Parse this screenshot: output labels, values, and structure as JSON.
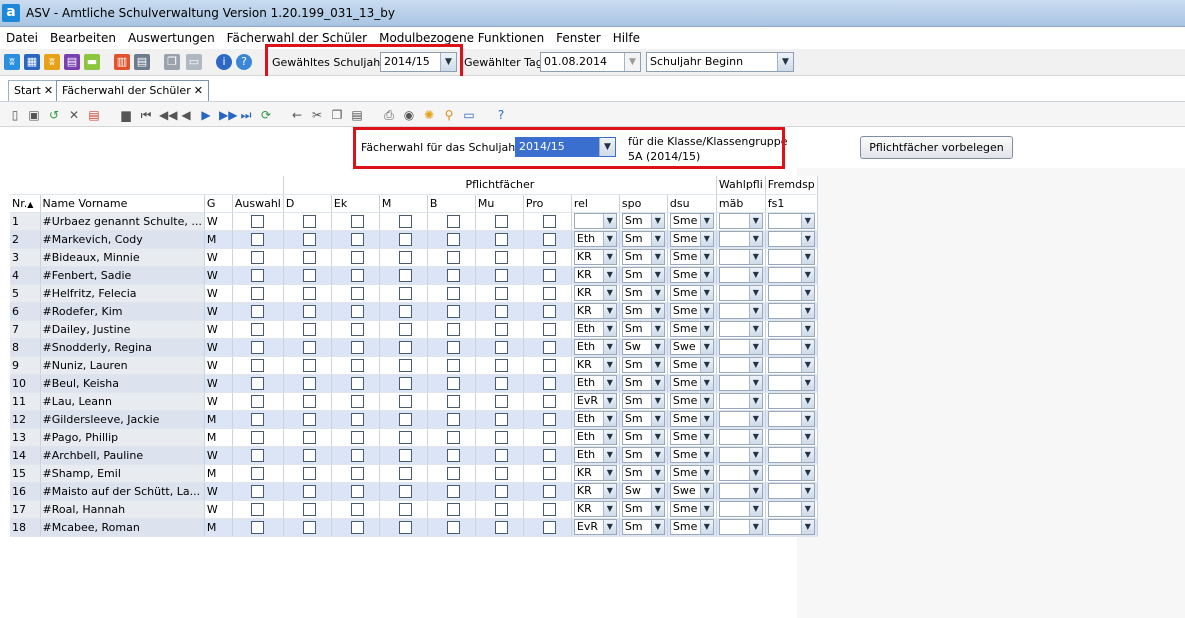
{
  "window": {
    "title": "ASV - Amtliche Schulverwaltung Version 1.20.199_031_13_by",
    "app_icon": "a"
  },
  "menu": [
    "Datei",
    "Bearbeiten",
    "Auswertungen",
    "Fächerwahl der Schüler",
    "Modulbezogene Funktionen",
    "Fenster",
    "Hilfe"
  ],
  "toolbar": {
    "school_year_label": "Gewähltes Schuljahr",
    "school_year_value": "2014/15",
    "day_label": "Gewählter Tag",
    "day_value": "01.08.2014",
    "period_value": "Schuljahr Beginn"
  },
  "tabs": [
    "Start",
    "Fächerwahl der Schüler"
  ],
  "panel": {
    "year_label": "Fächerwahl für das Schuljahr",
    "year_value": "2014/15",
    "class_label": "für die Klasse/Klassengruppe",
    "class_value": "5A (2014/15)",
    "button_label": "Pflichtfächer vorbelegen"
  },
  "grid": {
    "group_headers": {
      "mandatory": "Pflichtfächer",
      "elective": "Wahlpfli",
      "foreign": "Fremdsp"
    },
    "columns": [
      "Nr.",
      "Name Vorname",
      "G",
      "Auswahl",
      "D",
      "Ek",
      "M",
      "B",
      "Mu",
      "Pro",
      "rel",
      "spo",
      "dsu",
      "mäb",
      "fs1"
    ],
    "sort_indicator": "▲",
    "rows": [
      {
        "nr": "1",
        "name": "#Urbaez genannt Schulte, ...",
        "g": "W",
        "rel": "",
        "spo": "Sm",
        "dsu": "Sme"
      },
      {
        "nr": "2",
        "name": "#Markevich, Cody",
        "g": "M",
        "rel": "Eth",
        "spo": "Sm",
        "dsu": "Sme"
      },
      {
        "nr": "3",
        "name": "#Bideaux, Minnie",
        "g": "W",
        "rel": "KR",
        "spo": "Sm",
        "dsu": "Sme"
      },
      {
        "nr": "4",
        "name": "#Fenbert, Sadie",
        "g": "W",
        "rel": "KR",
        "spo": "Sm",
        "dsu": "Sme"
      },
      {
        "nr": "5",
        "name": "#Helfritz, Felecia",
        "g": "W",
        "rel": "KR",
        "spo": "Sm",
        "dsu": "Sme"
      },
      {
        "nr": "6",
        "name": "#Rodefer, Kim",
        "g": "W",
        "rel": "KR",
        "spo": "Sm",
        "dsu": "Sme"
      },
      {
        "nr": "7",
        "name": "#Dailey, Justine",
        "g": "W",
        "rel": "Eth",
        "spo": "Sm",
        "dsu": "Sme"
      },
      {
        "nr": "8",
        "name": "#Snodderly, Regina",
        "g": "W",
        "rel": "Eth",
        "spo": "Sw",
        "dsu": "Swe"
      },
      {
        "nr": "9",
        "name": "#Nuniz, Lauren",
        "g": "W",
        "rel": "KR",
        "spo": "Sm",
        "dsu": "Sme"
      },
      {
        "nr": "10",
        "name": "#Beul, Keisha",
        "g": "W",
        "rel": "Eth",
        "spo": "Sm",
        "dsu": "Sme"
      },
      {
        "nr": "11",
        "name": "#Lau, Leann",
        "g": "W",
        "rel": "EvR",
        "spo": "Sm",
        "dsu": "Sme"
      },
      {
        "nr": "12",
        "name": "#Gildersleeve, Jackie",
        "g": "M",
        "rel": "Eth",
        "spo": "Sm",
        "dsu": "Sme"
      },
      {
        "nr": "13",
        "name": "#Pago, Phillip",
        "g": "M",
        "rel": "Eth",
        "spo": "Sm",
        "dsu": "Sme"
      },
      {
        "nr": "14",
        "name": "#Archbell, Pauline",
        "g": "W",
        "rel": "Eth",
        "spo": "Sm",
        "dsu": "Sme"
      },
      {
        "nr": "15",
        "name": "#Shamp, Emil",
        "g": "M",
        "rel": "KR",
        "spo": "Sm",
        "dsu": "Sme"
      },
      {
        "nr": "16",
        "name": "#Maisto auf der Schütt, La...",
        "g": "W",
        "rel": "KR",
        "spo": "Sw",
        "dsu": "Swe"
      },
      {
        "nr": "17",
        "name": "#Roal, Hannah",
        "g": "W",
        "rel": "KR",
        "spo": "Sm",
        "dsu": "Sme"
      },
      {
        "nr": "18",
        "name": "#Mcabee, Roman",
        "g": "M",
        "rel": "EvR",
        "spo": "Sm",
        "dsu": "Sme"
      }
    ]
  },
  "colors": {
    "highlight_red": "#e0101a",
    "row_alt": "#dbe5f5",
    "selected_blue": "#3a6fd0"
  }
}
